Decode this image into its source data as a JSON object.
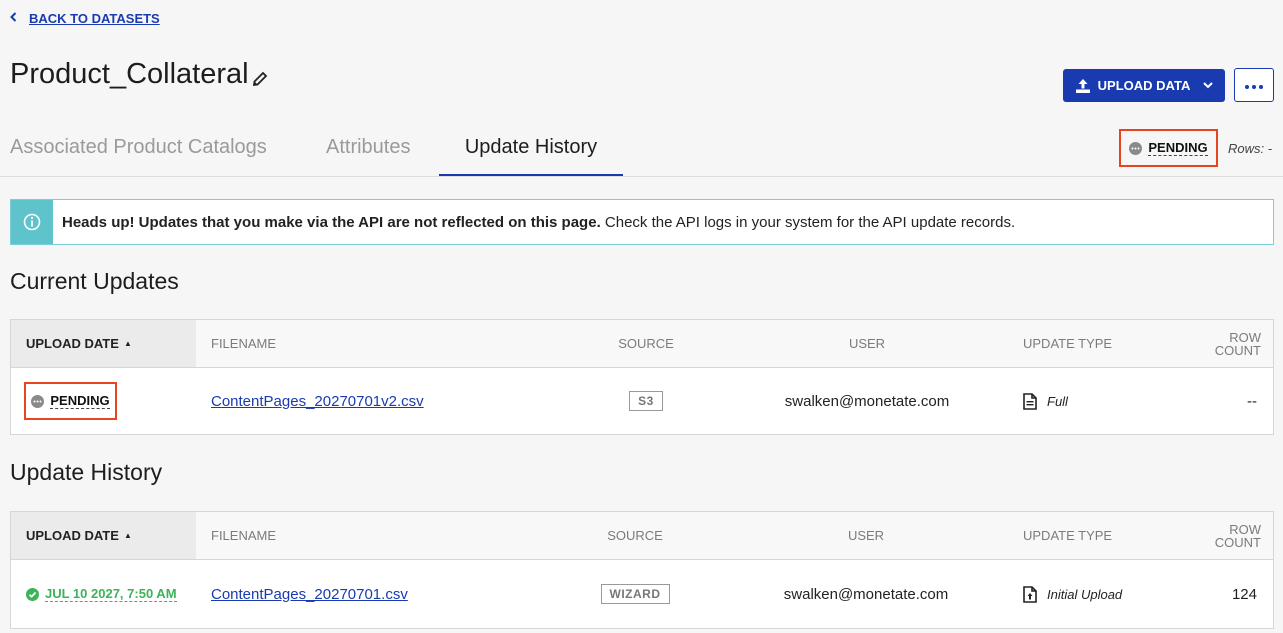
{
  "nav": {
    "back_label": "BACK TO DATASETS"
  },
  "header": {
    "title": "Product_Collateral",
    "upload_label": "UPLOAD DATA"
  },
  "tabs": [
    {
      "label": "Associated Product Catalogs"
    },
    {
      "label": "Attributes"
    },
    {
      "label": "Update History",
      "active": true
    }
  ],
  "status": {
    "label": "PENDING",
    "rows_label": "Rows: -"
  },
  "alert": {
    "bold_text": "Heads up! Updates that you make via the API are not reflected on this page.",
    "text": " Check the API logs in your system for the API update records."
  },
  "current_updates": {
    "title": "Current Updates",
    "headers": {
      "upload_date": "UPLOAD DATE",
      "filename": "FILENAME",
      "source": "SOURCE",
      "user": "USER",
      "update_type": "UPDATE TYPE",
      "row_count_1": "ROW",
      "row_count_2": "COUNT"
    },
    "row": {
      "status": "PENDING",
      "filename": "ContentPages_20270701v2.csv",
      "source": "S3",
      "user": "swalken@monetate.com",
      "update_type": "Full",
      "row_count": "--"
    }
  },
  "update_history": {
    "title": "Update History",
    "headers": {
      "upload_date": "UPLOAD DATE",
      "filename": "FILENAME",
      "source": "SOURCE",
      "user": "USER",
      "update_type": "UPDATE TYPE",
      "row_count_1": "ROW",
      "row_count_2": "COUNT"
    },
    "row": {
      "date": "JUL 10 2027, 7:50 AM",
      "filename": "ContentPages_20270701.csv",
      "source": "WIZARD",
      "user": "swalken@monetate.com",
      "update_type": "Initial Upload",
      "row_count": "124"
    }
  },
  "colors": {
    "accent": "#1a3bb0",
    "highlight": "#e8441d",
    "success": "#3cb35a",
    "info": "#5fc3cc"
  }
}
